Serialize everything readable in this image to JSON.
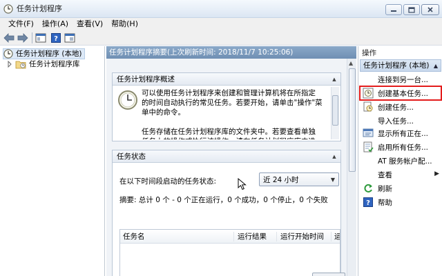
{
  "window": {
    "title": "任务计划程序",
    "controls": {
      "minimize": "─",
      "maximize": "□",
      "close": "✕"
    }
  },
  "menu": [
    "文件(F)",
    "操作(A)",
    "查看(V)",
    "帮助(H)"
  ],
  "toolbar": {
    "icons": [
      "back-arrow-icon",
      "forward-arrow-icon",
      "show-hide-console-tree-icon",
      "help-icon",
      "properties-icon"
    ]
  },
  "tree": {
    "root": "任务计划程序 (本地)",
    "library": "任务计划程序库"
  },
  "center": {
    "header": "任务计划程序摘要(上次刷新时间: 2018/11/7 10:25:06)",
    "overview": {
      "title": "任务计划程序概述",
      "paragraph1": "可以使用任务计划程序来创建和管理计算机将在所指定的时间自动执行的常见任务。若要开始，请单击\"操作\"菜单中的命令。",
      "paragraph2": "任务存储在任务计划程序库的文件夹中。若要查看单独任务上的操作或执行该操作，请在任务计划程序库中选择该任"
    },
    "status": {
      "title": "任务状态",
      "label": "在以下时间段启动的任务状态:",
      "period_selected": "近 24 小时",
      "summary": "摘要: 总计 0 个 - 0 个正在运行，0 个成功，0 个停止，0 个失败",
      "columns": [
        "任务名",
        "运行结果",
        "运行开始时间",
        "运"
      ]
    }
  },
  "actions": {
    "title": "操作",
    "group": "任务计划程序 (本地)",
    "items": [
      {
        "label": "连接到另一台...",
        "icon": "none",
        "has_submenu": false
      },
      {
        "label": "创建基本任务...",
        "icon": "create-basic-task-icon",
        "has_submenu": false,
        "highlighted": true
      },
      {
        "label": "创建任务...",
        "icon": "create-task-icon",
        "has_submenu": false
      },
      {
        "label": "导入任务...",
        "icon": "none",
        "has_submenu": false
      },
      {
        "label": "显示所有正在...",
        "icon": "running-tasks-icon",
        "has_submenu": false
      },
      {
        "label": "启用所有任务...",
        "icon": "enable-history-icon",
        "has_submenu": false
      },
      {
        "label": "AT 服务帐户配...",
        "icon": "none",
        "has_submenu": false
      },
      {
        "label": "查看",
        "icon": "none",
        "has_submenu": true
      },
      {
        "label": "刷新",
        "icon": "refresh-icon",
        "has_submenu": false
      },
      {
        "label": "帮助",
        "icon": "help-icon",
        "has_submenu": false
      }
    ]
  },
  "colors": {
    "center_header": "#7a98bb",
    "highlight_box": "#e31b1b",
    "selection": "#dde9f7"
  }
}
